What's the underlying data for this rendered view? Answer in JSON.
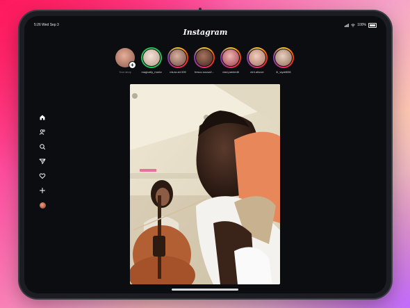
{
  "status_bar": {
    "time": "5:26",
    "date": "Wed Sep 3",
    "battery_text": "100%"
  },
  "app": {
    "title": "Instagram"
  },
  "stories": [
    {
      "name": "Your story",
      "own": true,
      "ring": "none",
      "avatar_color": "#c98d76"
    },
    {
      "name": "magically_marta",
      "ring": "close-friends",
      "avatar_color": "#e8cdbb"
    },
    {
      "name": "miura.art.999",
      "ring": "gradient",
      "avatar_color": "#b98c7c"
    },
    {
      "name": "fresco.sousa2...",
      "ring": "gradient",
      "avatar_color": "#8a5a48"
    },
    {
      "name": "vlad.painted8",
      "ring": "gradient",
      "avatar_color": "#c86e74"
    },
    {
      "name": "eirri.allover",
      "ring": "gradient",
      "avatar_color": "#d9a796"
    },
    {
      "name": "lil_wyatt838",
      "ring": "gradient",
      "avatar_color": "#caa18e"
    }
  ],
  "sidebar": {
    "items": [
      {
        "icon": "home-icon",
        "label": "Home"
      },
      {
        "icon": "people-icon",
        "label": "Friends"
      },
      {
        "icon": "search-icon",
        "label": "Search"
      },
      {
        "icon": "send-icon",
        "label": "Messages"
      },
      {
        "icon": "heart-icon",
        "label": "Notifications"
      },
      {
        "icon": "plus-icon",
        "label": "Create"
      },
      {
        "icon": "profile-avatar",
        "label": "Profile"
      }
    ]
  },
  "post": {
    "subject": "selfie-with-cellist"
  },
  "colors": {
    "background_pink": "#ff2d6f",
    "background_purple": "#c26bff",
    "screen": "#0c0d10",
    "close_friends_ring": "#22c55e"
  }
}
